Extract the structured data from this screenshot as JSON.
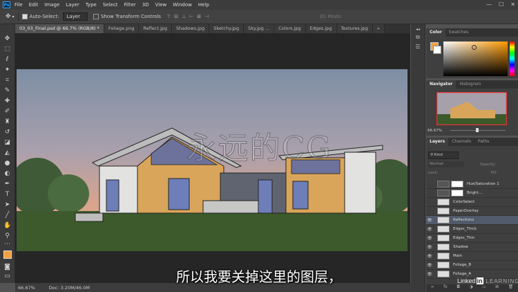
{
  "app": {
    "logo": "Ps"
  },
  "menu": [
    "File",
    "Edit",
    "Image",
    "Layer",
    "Type",
    "Select",
    "Filter",
    "3D",
    "View",
    "Window",
    "Help"
  ],
  "window_controls": [
    "—",
    "☐",
    "✕"
  ],
  "options": {
    "auto_select": "Auto-Select:",
    "layer_mode": "Layer",
    "transform": "Show Transform Controls",
    "mode_3d": "3D Mode:"
  },
  "tabs": [
    "03_03_Final.psd @ 66.7% (RGB/8) *",
    "Foliage.png",
    "Reflect.jpg",
    "Shadows.jpg",
    "Sketchy.jpg",
    "Sky.jpg ...",
    "Colors.jpg",
    "Edges.jpg",
    "Textures.jpg",
    "»"
  ],
  "status": {
    "zoom": "66.67%",
    "doc": "Doc: 3.20M/46.0M"
  },
  "color_panel": {
    "tabs": [
      "Color",
      "Swatches"
    ],
    "fg": "#f0a040"
  },
  "navigator": {
    "tabs": [
      "Navigator",
      "Histogram"
    ],
    "zoom": "66.67%"
  },
  "layers_panel": {
    "tabs": [
      "Layers",
      "Channels",
      "Paths"
    ],
    "filter": "Kind",
    "blend": "Normal",
    "opacity_label": "Opacity:",
    "lock_label": "Lock:",
    "fill_label": "Fill:",
    "layers": [
      {
        "name": "Hue/Saturation 1",
        "visible": false,
        "adjust": true
      },
      {
        "name": "Bright...",
        "visible": false,
        "adjust": true
      },
      {
        "name": "ColorSelect",
        "visible": false
      },
      {
        "name": "PaperOverlay",
        "visible": false
      },
      {
        "name": "Reflections",
        "visible": true,
        "selected": true
      },
      {
        "name": "Edges_Thick",
        "visible": true
      },
      {
        "name": "Edges_Thin",
        "visible": true
      },
      {
        "name": "Shadow",
        "visible": true
      },
      {
        "name": "Main",
        "visible": true
      },
      {
        "name": "Foliage_B",
        "visible": true
      },
      {
        "name": "Foliage_A",
        "visible": true
      }
    ]
  },
  "subtitle": "所以我要关掉这里的图层，",
  "watermark": "永远的CG",
  "branding": {
    "linked": "Linked",
    "in": "in",
    "learning": "LEARNING"
  }
}
